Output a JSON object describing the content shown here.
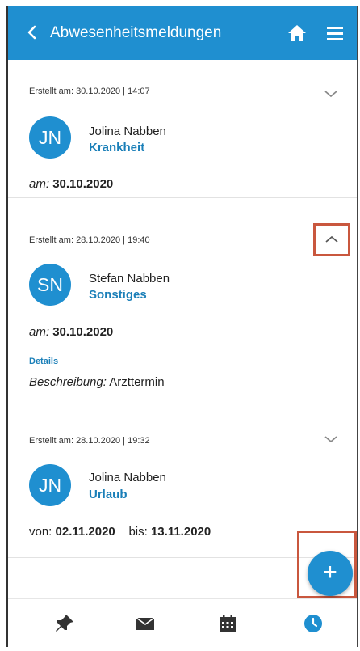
{
  "header": {
    "title": "Abwesenheitsmeldungen",
    "back_icon": "chevron-left-icon",
    "home_icon": "home-icon",
    "menu_icon": "hamburger-menu-icon"
  },
  "cards": [
    {
      "created": "Erstellt am: 30.10.2020 | 14:07",
      "initials": "JN",
      "name": "Jolina Nabben",
      "type": "Krankheit",
      "date_prefix": "am:",
      "date_value": "30.10.2020",
      "expanded": false
    },
    {
      "created": "Erstellt am: 28.10.2020 | 19:40",
      "initials": "SN",
      "name": "Stefan Nabben",
      "type": "Sonstiges",
      "date_prefix": "am:",
      "date_value": "30.10.2020",
      "expanded": true,
      "details_label": "Details",
      "description_label": "Beschreibung:",
      "description_value": "Arzttermin"
    },
    {
      "created": "Erstellt am: 28.10.2020 | 19:32",
      "initials": "JN",
      "name": "Jolina Nabben",
      "type": "Urlaub",
      "from_label": "von:",
      "from_value": "02.11.2020",
      "to_label": "bis:",
      "to_value": "13.11.2020",
      "expanded": false
    }
  ],
  "fab": {
    "label": "+"
  },
  "bottom_nav": [
    {
      "icon": "pin-icon"
    },
    {
      "icon": "mail-icon"
    },
    {
      "icon": "calendar-icon"
    },
    {
      "icon": "clock-icon",
      "active": true
    }
  ],
  "colors": {
    "primary": "#1f8fd0",
    "accent_text": "#1a7fb8",
    "highlight": "#c9573e"
  }
}
